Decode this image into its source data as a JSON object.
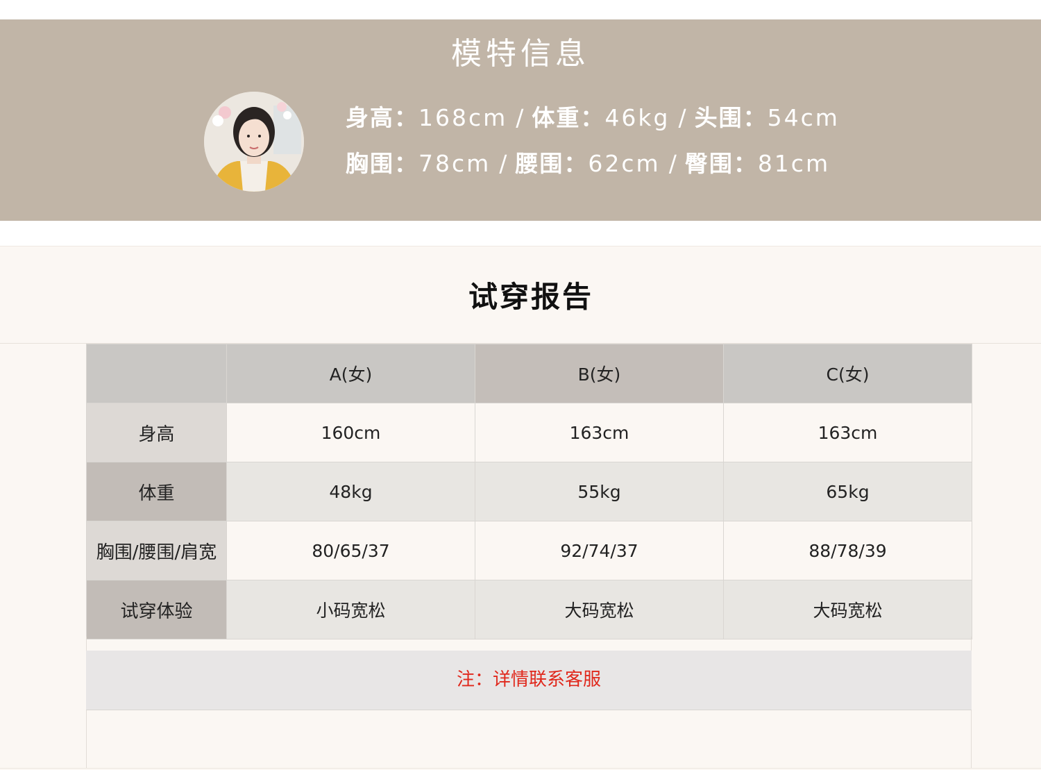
{
  "model_info": {
    "title": "模特信息",
    "line1": {
      "height_label": "身高：",
      "height_value": "168cm",
      "weight_label": "体重：",
      "weight_value": "46kg",
      "head_label": "头围：",
      "head_value": "54cm"
    },
    "line2": {
      "bust_label": "胸围：",
      "bust_value": "78cm",
      "waist_label": "腰围：",
      "waist_value": "62cm",
      "hip_label": "臀围：",
      "hip_value": "81cm"
    },
    "separator": "/"
  },
  "report": {
    "title": "试穿报告",
    "table": {
      "headers": [
        "",
        "A(女)",
        "B(女)",
        "C(女)"
      ],
      "rows": [
        {
          "label": "身高",
          "values": [
            "160cm",
            "163cm",
            "163cm"
          ]
        },
        {
          "label": "体重",
          "values": [
            "48kg",
            "55kg",
            "65kg"
          ]
        },
        {
          "label": "胸围/腰围/肩宽",
          "values": [
            "80/65/37",
            "92/74/37",
            "88/78/39"
          ]
        },
        {
          "label": "试穿体验",
          "values": [
            "小码宽松",
            "大码宽松",
            "大码宽松"
          ]
        }
      ]
    },
    "note": "注：详情联系客服"
  },
  "colors": {
    "banner_bg": "#c1b5a7",
    "note_text": "#e0281c"
  }
}
